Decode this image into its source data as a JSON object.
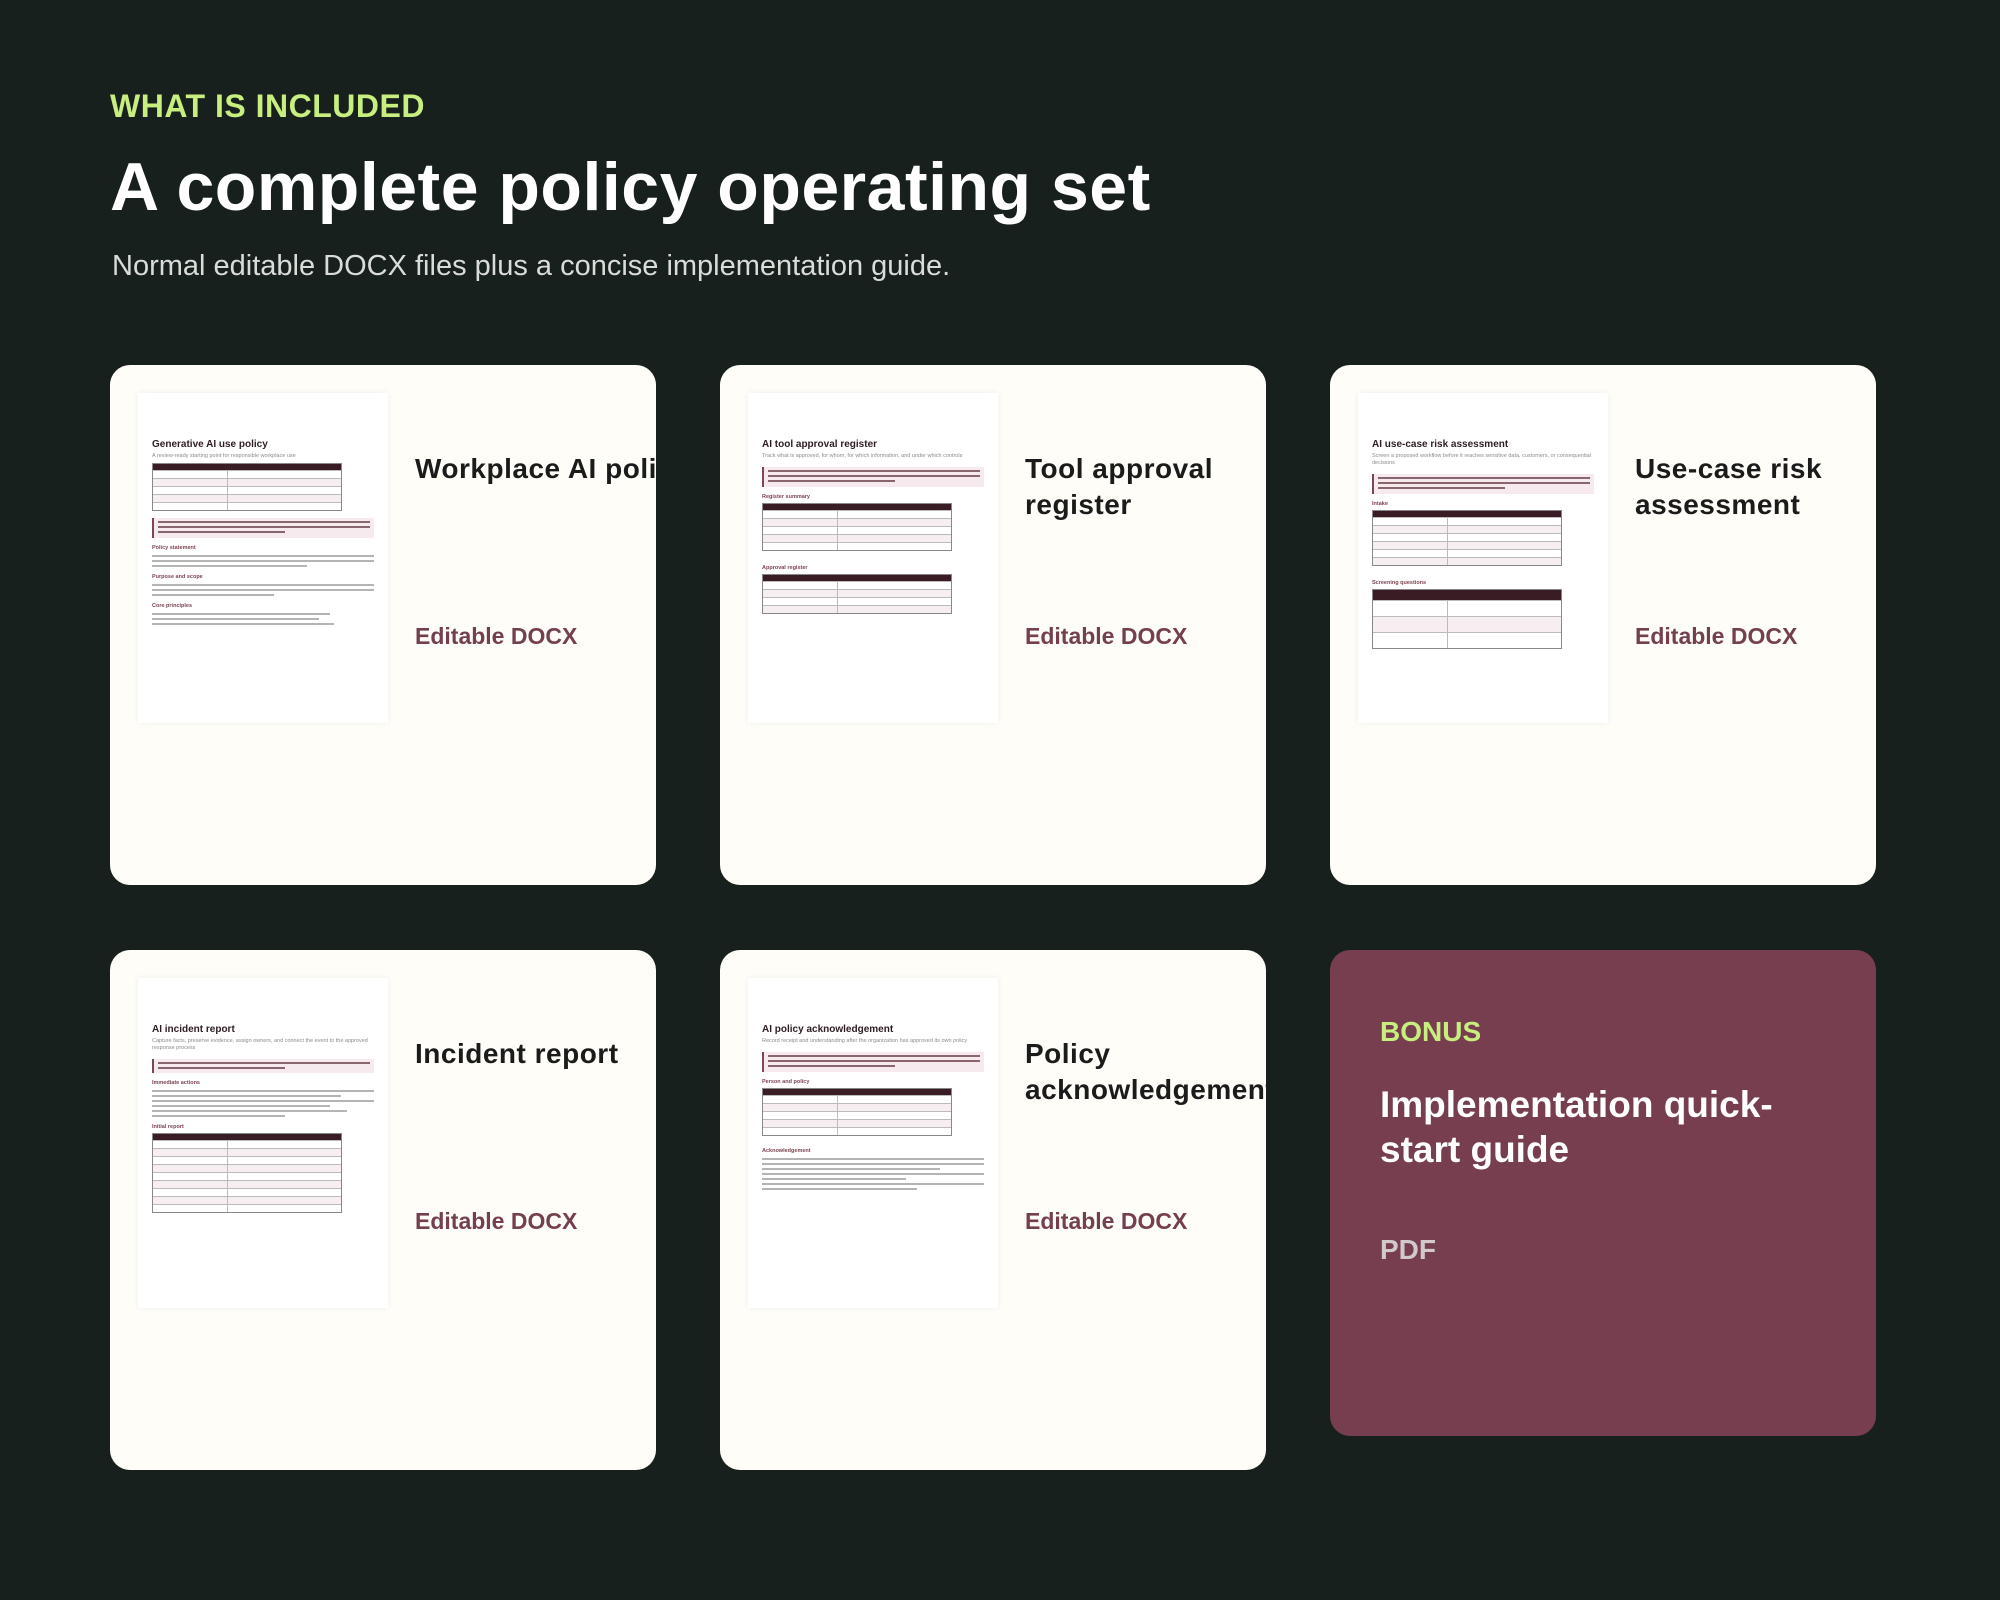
{
  "header": {
    "eyebrow": "WHAT IS INCLUDED",
    "title": "A complete policy operating set",
    "subtitle": "Normal editable DOCX files plus a concise implementation guide."
  },
  "cards": [
    {
      "label": "Workplace AI policy",
      "format": "Editable DOCX",
      "doc_title": "Generative AI use policy",
      "doc_subtitle": "A review-ready starting point for responsible workplace use",
      "sections": [
        "Policy statement",
        "Purpose and scope",
        "Core principles"
      ]
    },
    {
      "label": "Tool approval register",
      "format": "Editable DOCX",
      "doc_title": "AI tool approval register",
      "doc_subtitle": "Track what is approved, for whom, for which information, and under which controls",
      "sections": [
        "Register summary",
        "Approval register"
      ]
    },
    {
      "label": "Use-case risk assessment",
      "format": "Editable DOCX",
      "doc_title": "AI use-case risk assessment",
      "doc_subtitle": "Screen a proposed workflow before it reaches sensitive data, customers, or consequential decisions",
      "sections": [
        "Intake",
        "Screening questions"
      ]
    },
    {
      "label": "Incident report",
      "format": "Editable DOCX",
      "doc_title": "AI incident report",
      "doc_subtitle": "Capture facts, preserve evidence, assign owners, and connect the event to the approved response process",
      "sections": [
        "Immediate actions",
        "Initial report"
      ]
    },
    {
      "label": "Policy acknowledgement",
      "format": "Editable DOCX",
      "doc_title": "AI policy acknowledgement",
      "doc_subtitle": "Record receipt and understanding after the organization has approved its own policy",
      "sections": [
        "Person and policy",
        "Acknowledgement"
      ]
    }
  ],
  "bonus": {
    "tag": "BONUS",
    "title": "Implementation quick-start guide",
    "format": "PDF"
  },
  "colors": {
    "background": "#17201c",
    "accent": "#c7ee7f",
    "card": "#fefdf7",
    "brand": "#763e4f"
  }
}
